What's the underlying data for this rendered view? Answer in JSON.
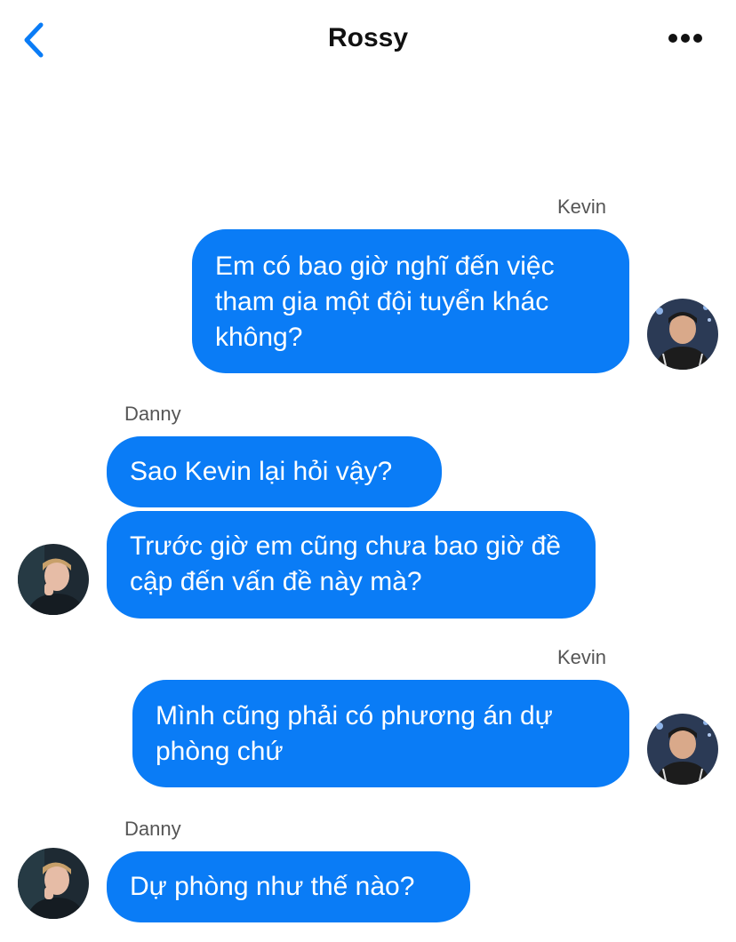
{
  "header": {
    "title": "Rossy",
    "back_icon": "chevron-left-icon",
    "more_icon": "more-horizontal-icon",
    "accent": "#0a7cf6"
  },
  "messages": [
    {
      "sender": "Kevin",
      "side": "right",
      "text": "Em có bao giờ nghĩ đến việc tham gia một đội tuyển khác không?"
    },
    {
      "sender": "Danny",
      "side": "left",
      "text": "Sao Kevin lại hỏi vậy?"
    },
    {
      "sender": "",
      "side": "left",
      "text": "Trước giờ em cũng chưa bao giờ đề cập đến vấn đề này mà?"
    },
    {
      "sender": "Kevin",
      "side": "right",
      "text": "Mình cũng phải có phương án dự phòng chứ"
    },
    {
      "sender": "Danny",
      "side": "left",
      "text": "Dự phòng như thế nào?"
    }
  ],
  "colors": {
    "bubble": "#0a7cf6",
    "bubble_text": "#ffffff",
    "sender_label": "#555555"
  }
}
